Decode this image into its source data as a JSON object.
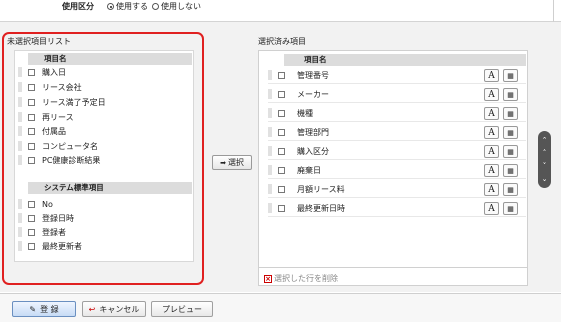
{
  "usage": {
    "label": "使用区分",
    "options": [
      {
        "label": "使用する",
        "selected": true
      },
      {
        "label": "使用しない",
        "selected": false
      }
    ]
  },
  "left": {
    "title": "未選択項目リスト",
    "group1": {
      "header": "項目名",
      "items": [
        "購入日",
        "リース会社",
        "リース満了予定日",
        "再リース",
        "付属品",
        "コンピュータ名",
        "PC健康診断結果"
      ]
    },
    "group2": {
      "header": "システム標準項目",
      "items": [
        "No",
        "登録日時",
        "登録者",
        "最終更新者"
      ]
    }
  },
  "select_button": {
    "label": "選択"
  },
  "right": {
    "title": "選択済み項目",
    "header": "項目名",
    "items": [
      "管理番号",
      "メーカー",
      "機種",
      "管理部門",
      "購入区分",
      "廃棄日",
      "月額リース料",
      "最終更新日時"
    ],
    "delete_label": "選択した行を削除"
  },
  "footer": {
    "register": "登 録",
    "cancel": "キャンセル",
    "preview": "プレビュー"
  },
  "colors": {
    "highlight": "#e02020",
    "delete_icon": "#cc0000",
    "cancel_icon": "#cc0000"
  },
  "icons": {
    "register": "pencil-icon",
    "cancel": "undo-arrow-icon",
    "select": "arrow-right-icon",
    "text_format": "font-a-icon",
    "item_settings": "settings-table-icon",
    "navigation": [
      "move-top-icon",
      "move-up-icon",
      "move-down-icon",
      "move-bottom-icon"
    ]
  }
}
